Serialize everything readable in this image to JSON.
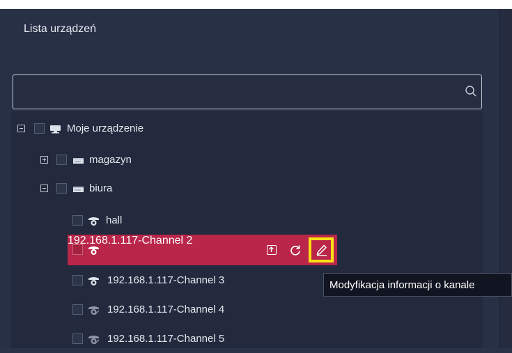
{
  "panel": {
    "title": "Lista urządzeń"
  },
  "search": {
    "value": "",
    "placeholder": "",
    "icon": "search-icon"
  },
  "tree": {
    "root": {
      "label": "Moje urządzenie",
      "icon": "monitor-icon",
      "expanded": true
    },
    "groups": [
      {
        "label": "magazyn",
        "icon": "nvr-icon",
        "expanded": false
      },
      {
        "label": "biura",
        "icon": "nvr-icon",
        "expanded": true
      }
    ],
    "channels": [
      {
        "label": "hall",
        "icon": "dome-camera-icon",
        "status": "online",
        "selected": false
      },
      {
        "label": "192.168.1.117-Channel 2",
        "icon": "dome-camera-icon",
        "status": "online",
        "selected": true
      },
      {
        "label": "192.168.1.117-Channel 3",
        "icon": "dome-camera-icon",
        "status": "online",
        "selected": false
      },
      {
        "label": "192.168.1.117-Channel 4",
        "icon": "dome-camera-offline-icon",
        "status": "offline",
        "selected": false
      },
      {
        "label": "192.168.1.117-Channel 5",
        "icon": "dome-camera-offline-icon",
        "status": "offline",
        "selected": false
      }
    ]
  },
  "row_actions": {
    "upload": "upload-icon",
    "refresh": "refresh-icon",
    "edit": "edit-pencil-icon"
  },
  "tooltip": {
    "text": "Modyfikacja informacji o kanale"
  },
  "colors": {
    "background": "#283046",
    "tree_background": "#232a3d",
    "selected_row": "#b9264a",
    "highlight": "#f7e014",
    "text": "#e4e7ee"
  }
}
